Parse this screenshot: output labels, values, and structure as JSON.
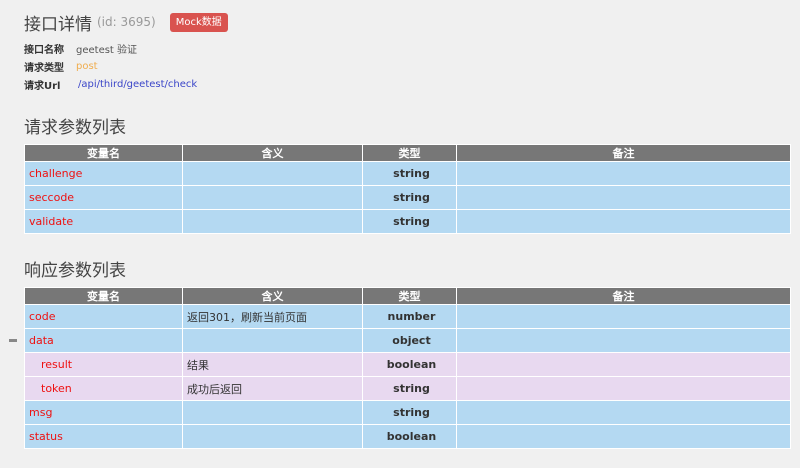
{
  "header": {
    "title": "接口详情",
    "id_text": "(id: 3695)",
    "mock_button": "Mock数据"
  },
  "info": {
    "name_label": "接口名称",
    "name_value": "geetest 验证",
    "method_label": "请求类型",
    "method_value": "post",
    "url_label": "请求Url",
    "url_value": "/api/third/geetest/check"
  },
  "columns": {
    "name": "变量名",
    "meaning": "含义",
    "type": "类型",
    "note": "备注"
  },
  "request": {
    "title": "请求参数列表",
    "rows": [
      {
        "name": "challenge",
        "meaning": "",
        "type": "string",
        "note": ""
      },
      {
        "name": "seccode",
        "meaning": "",
        "type": "string",
        "note": ""
      },
      {
        "name": "validate",
        "meaning": "",
        "type": "string",
        "note": ""
      }
    ]
  },
  "response": {
    "title": "响应参数列表",
    "rows": [
      {
        "name": "code",
        "meaning": "返回301，刷新当前页面",
        "type": "number",
        "note": ""
      },
      {
        "name": "data",
        "meaning": "",
        "type": "object",
        "note": ""
      },
      {
        "name": "result",
        "meaning": "结果",
        "type": "boolean",
        "note": ""
      },
      {
        "name": "token",
        "meaning": "成功后返回",
        "type": "string",
        "note": ""
      },
      {
        "name": "msg",
        "meaning": "",
        "type": "string",
        "note": ""
      },
      {
        "name": "status",
        "meaning": "",
        "type": "boolean",
        "note": ""
      }
    ]
  }
}
